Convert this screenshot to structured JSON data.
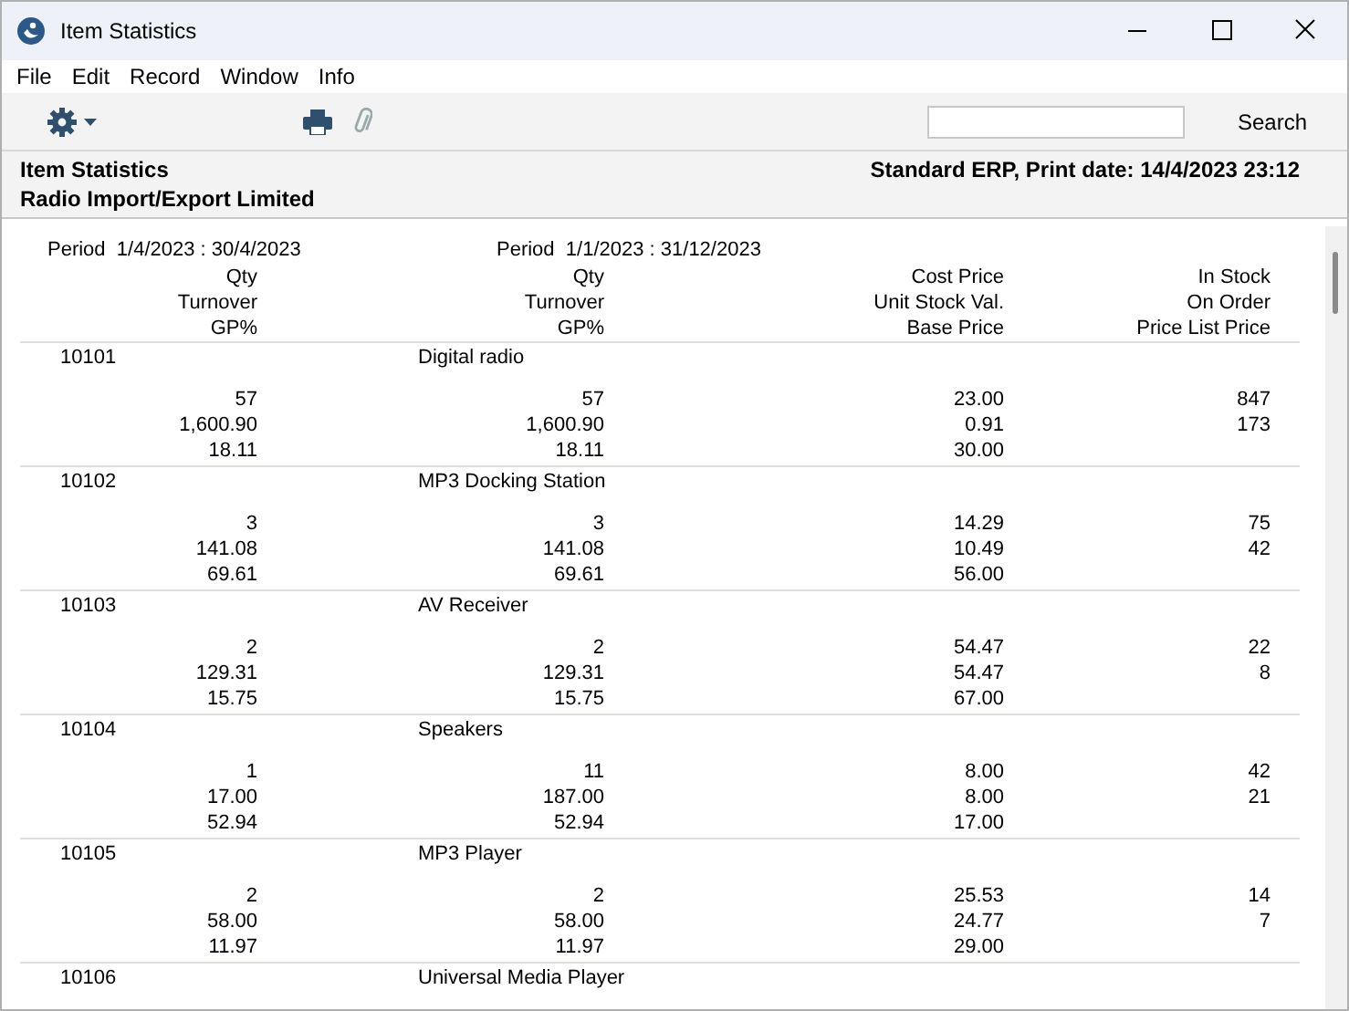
{
  "window": {
    "title": "Item Statistics"
  },
  "menu": [
    "File",
    "Edit",
    "Record",
    "Window",
    "Info"
  ],
  "toolbar": {
    "search_button": "Search"
  },
  "report_header": {
    "title": "Item Statistics",
    "company": "Radio Import/Export Limited",
    "info": "Standard ERP, Print date: 14/4/2023 23:12"
  },
  "periods": [
    "Period  1/4/2023 : 30/4/2023",
    "Period  1/1/2023 : 31/12/2023"
  ],
  "column_headings": [
    [
      "Qty",
      "Qty",
      "Cost Price",
      "In Stock"
    ],
    [
      "Turnover",
      "Turnover",
      "Unit Stock Val.",
      "On Order"
    ],
    [
      "GP%",
      "GP%",
      "Base Price",
      "Price List Price"
    ]
  ],
  "items": [
    {
      "code": "10101",
      "name": "Digital radio",
      "lines": [
        [
          "57",
          "57",
          "23.00",
          "847"
        ],
        [
          "1,600.90",
          "1,600.90",
          "0.91",
          "173"
        ],
        [
          "18.11",
          "18.11",
          "30.00"
        ]
      ]
    },
    {
      "code": "10102",
      "name": "MP3 Docking Station",
      "lines": [
        [
          "3",
          "3",
          "14.29",
          "75"
        ],
        [
          "141.08",
          "141.08",
          "10.49",
          "42"
        ],
        [
          "69.61",
          "69.61",
          "56.00"
        ]
      ]
    },
    {
      "code": "10103",
      "name": "AV Receiver",
      "lines": [
        [
          "2",
          "2",
          "54.47",
          "22"
        ],
        [
          "129.31",
          "129.31",
          "54.47",
          "8"
        ],
        [
          "15.75",
          "15.75",
          "67.00"
        ]
      ]
    },
    {
      "code": "10104",
      "name": "Speakers",
      "lines": [
        [
          "1",
          "11",
          "8.00",
          "42"
        ],
        [
          "17.00",
          "187.00",
          "8.00",
          "21"
        ],
        [
          "52.94",
          "52.94",
          "17.00"
        ]
      ]
    },
    {
      "code": "10105",
      "name": "MP3 Player",
      "lines": [
        [
          "2",
          "2",
          "25.53",
          "14"
        ],
        [
          "58.00",
          "58.00",
          "24.77",
          "7"
        ],
        [
          "11.97",
          "11.97",
          "29.00"
        ]
      ]
    },
    {
      "code": "10106",
      "name": "Universal Media Player"
    }
  ]
}
